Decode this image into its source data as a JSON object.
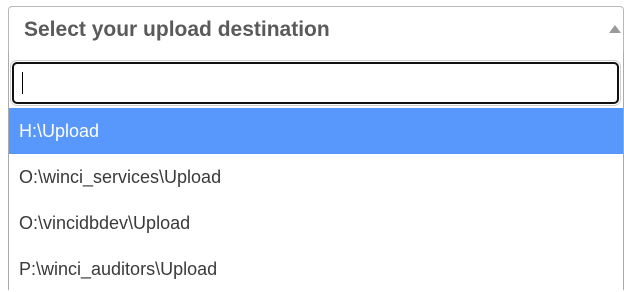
{
  "select": {
    "placeholder": "Select your upload destination",
    "search_value": "",
    "options": [
      {
        "label": "H:\\Upload",
        "highlighted": true
      },
      {
        "label": "O:\\winci_services\\Upload",
        "highlighted": false
      },
      {
        "label": "O:\\vincidbdev\\Upload",
        "highlighted": false
      },
      {
        "label": "P:\\winci_auditors\\Upload",
        "highlighted": false
      }
    ]
  },
  "colors": {
    "highlight": "#5897fb",
    "highlight_text": "#ffffff",
    "option_text": "#3a3a3a"
  },
  "icons": {
    "arrow": "chevron-up-icon"
  }
}
